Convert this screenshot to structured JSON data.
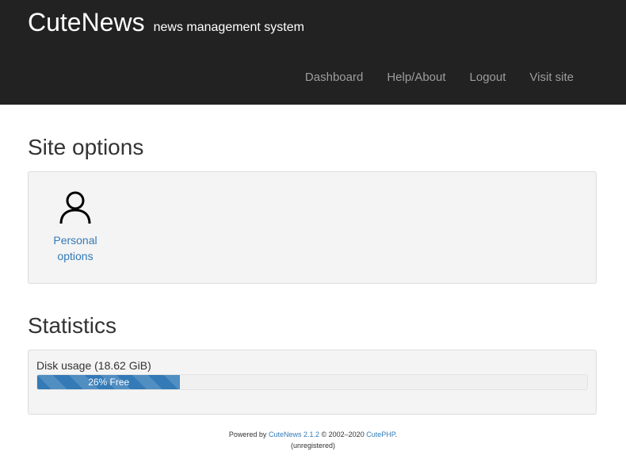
{
  "header": {
    "brand": "CuteNews",
    "tagline": "news management system",
    "nav": [
      "Dashboard",
      "Help/About",
      "Logout",
      "Visit site"
    ]
  },
  "site_options": {
    "title": "Site options",
    "items": [
      {
        "label_line1": "Personal",
        "label_line2": "options",
        "icon": "user-icon"
      }
    ]
  },
  "statistics": {
    "title": "Statistics",
    "disk_usage_label": "Disk usage (18.62 GiB)",
    "free_percent": 26,
    "free_text": "26% Free"
  },
  "footer": {
    "powered_by": "Powered by",
    "product": "CuteNews",
    "version": "2.1.2",
    "copyright": "© 2002–2020",
    "company": "CutePHP",
    "period": ".",
    "registration": "(unregistered)"
  },
  "colors": {
    "topbar": "#222222",
    "link": "#337ab7",
    "progress": "#337ab7"
  }
}
